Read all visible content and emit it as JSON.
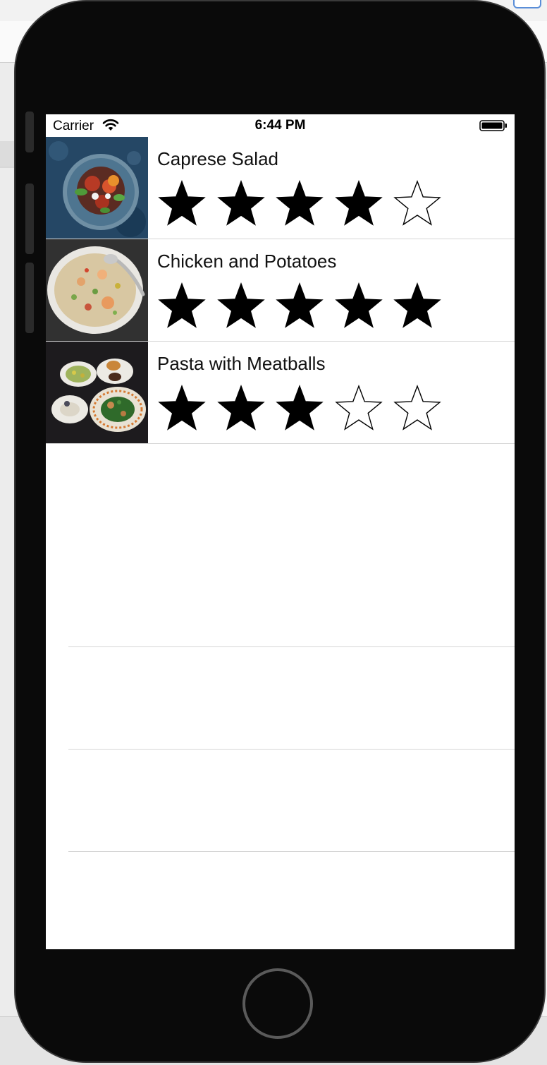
{
  "status_bar": {
    "carrier": "Carrier",
    "time": "6:44 PM"
  },
  "recipes": [
    {
      "name": "Caprese Salad",
      "rating": 4,
      "max_rating": 5
    },
    {
      "name": "Chicken and Potatoes",
      "rating": 5,
      "max_rating": 5
    },
    {
      "name": "Pasta with Meatballs",
      "rating": 3,
      "max_rating": 5
    }
  ],
  "icons": {
    "wifi": "wifi-icon",
    "battery": "battery-icon",
    "star_filled": "star-filled-icon",
    "star_empty": "star-empty-icon",
    "home": "home-button"
  },
  "colors": {
    "phone_frame": "#0a0a0a",
    "screen_bg": "#ffffff",
    "separator": "#d6d6d6",
    "star": "#000000"
  }
}
